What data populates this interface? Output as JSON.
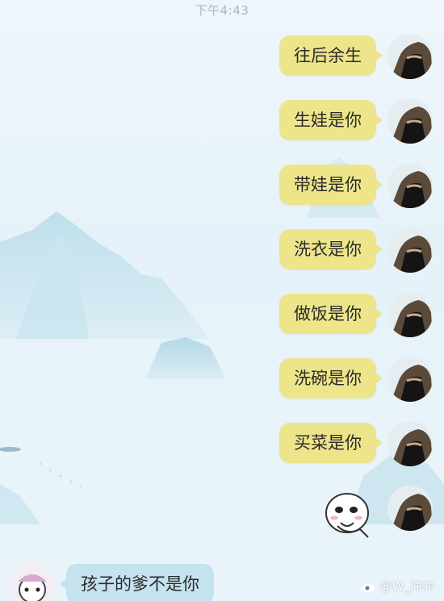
{
  "status": {
    "timestamp": "下午4:43"
  },
  "messages_right": [
    {
      "text": "往后余生"
    },
    {
      "text": "生娃是你"
    },
    {
      "text": "带娃是你"
    },
    {
      "text": "洗衣是你"
    },
    {
      "text": "做饭是你"
    },
    {
      "text": "洗碗是你"
    },
    {
      "text": "买菜是你"
    }
  ],
  "message_left": {
    "text": "孩子的爹不是你"
  },
  "watermark": {
    "text": "@W_冲冲"
  },
  "colors": {
    "right_bubble": "#eee58b",
    "left_bubble": "#c5e2ef",
    "background": "#e8f3f9"
  },
  "icons": {
    "avatar_right": "masked-face-avatar",
    "avatar_left": "girl-avatar",
    "sticker": "cartoon-blush-sticker",
    "watermark_logo": "weibo-logo"
  }
}
